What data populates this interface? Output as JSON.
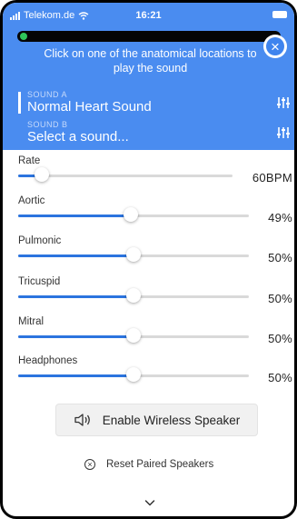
{
  "status_bar": {
    "carrier": "Telekom.de",
    "time": "16:21"
  },
  "instruction": "Click on one of the anatomical locations to play the sound",
  "sounds": [
    {
      "label": "SOUND A",
      "value": "Normal Heart Sound"
    },
    {
      "label": "SOUND B",
      "value": "Select a sound..."
    }
  ],
  "sliders": [
    {
      "name": "Rate",
      "value_text": "60BPM",
      "level": 0.11
    },
    {
      "name": "Aortic",
      "value_text": "49%",
      "level": 0.49
    },
    {
      "name": "Pulmonic",
      "value_text": "50%",
      "level": 0.5
    },
    {
      "name": "Tricuspid",
      "value_text": "50%",
      "level": 0.5
    },
    {
      "name": "Mitral",
      "value_text": "50%",
      "level": 0.5
    },
    {
      "name": "Headphones",
      "value_text": "50%",
      "level": 0.5
    }
  ],
  "speaker_button": {
    "label": "Enable Wireless Speaker",
    "icon": "speaker-icon"
  },
  "reset": {
    "label": "Reset Paired Speakers",
    "icon": "x-circle-icon"
  },
  "colors": {
    "header_blue": "#4a8cf0",
    "slider_fill": "#2b74df",
    "track": "#d9d9d9"
  }
}
